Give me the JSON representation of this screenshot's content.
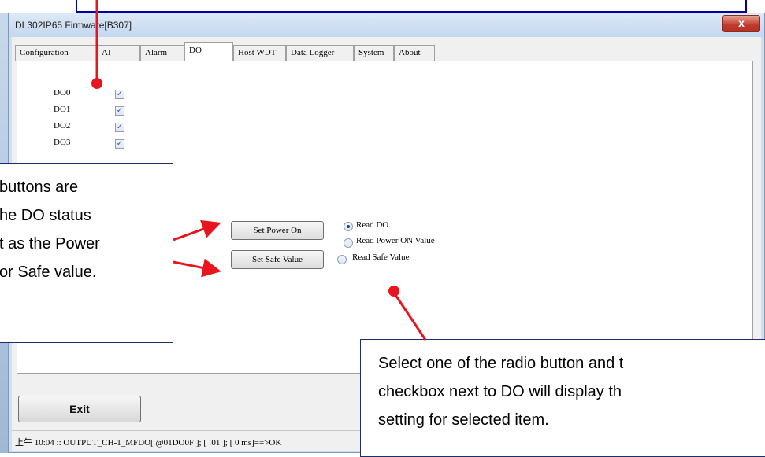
{
  "window": {
    "title": "DL302IP65 Firmware[B307]",
    "close_glyph": "x"
  },
  "tabs": [
    {
      "label": "Configuration"
    },
    {
      "label": "AI"
    },
    {
      "label": "Alarm"
    },
    {
      "label": "DO",
      "active": true
    },
    {
      "label": "Host WDT"
    },
    {
      "label": "Data Logger"
    },
    {
      "label": "System"
    },
    {
      "label": "About"
    }
  ],
  "do_channels": [
    {
      "label": "DO0",
      "checked": true
    },
    {
      "label": "DO1",
      "checked": true
    },
    {
      "label": "DO2",
      "checked": true
    },
    {
      "label": "DO3",
      "checked": true
    }
  ],
  "buttons": {
    "set_power_on": "Set Power On",
    "set_safe_value": "Set Safe Value",
    "exit": "Exit"
  },
  "radios": [
    {
      "label": "Read DO",
      "selected": true
    },
    {
      "label": "Read Power ON Value",
      "selected": false
    },
    {
      "label": "Read Safe Value",
      "selected": false
    }
  ],
  "status_bar": {
    "text": "上午 10:04 :: OUTPUT_CH-1_MFDO[ @01DO0F ]; [ !01 ]; [ 0 ms]==>OK"
  },
  "callouts": {
    "left": {
      "lines": [
        " buttons are",
        "he DO status",
        "t as the Power",
        "or Safe value."
      ]
    },
    "bottom": {
      "lines": [
        "Select one of the radio button and t",
        "checkbox next to DO will display th",
        "setting for selected item."
      ]
    }
  },
  "colors": {
    "annotation_arrow": "#e8141e",
    "callout_border": "#1e2e6a",
    "check_mark": "#3657a3"
  },
  "icons": {
    "checkbox_mark": "✓",
    "close": "close-icon"
  }
}
